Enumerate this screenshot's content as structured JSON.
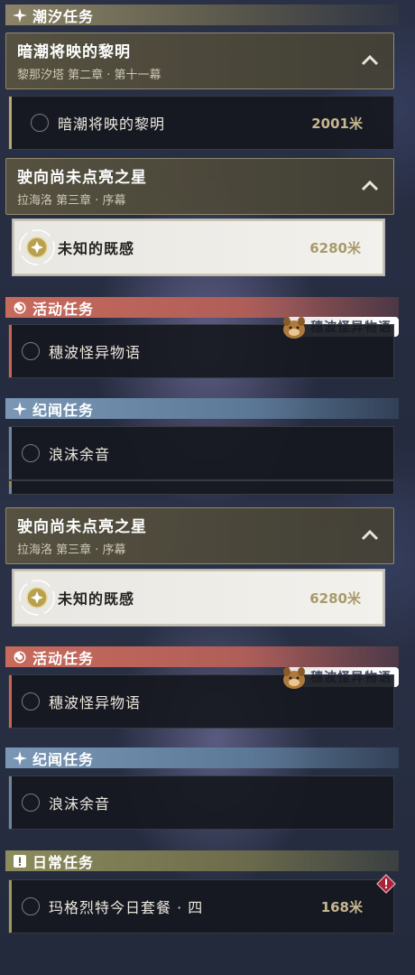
{
  "sections": {
    "tide": "潮汐任务",
    "event": "活动任务",
    "lore": "纪闻任务",
    "daily": "日常任务"
  },
  "chapter1": {
    "title": "暗潮将映的黎明",
    "subtitle": "黎那汐塔 第二章 · 第十一幕"
  },
  "quest1": {
    "name": "暗潮将映的黎明",
    "distance": "2001米"
  },
  "chapter2": {
    "title": "驶向尚未点亮之星",
    "subtitle": "拉海洛 第三章 · 序幕"
  },
  "quest2": {
    "name": "未知的既感",
    "distance": "6280米"
  },
  "event_quest": {
    "name": "穗波怪异物语",
    "badge": "穗波怪异物语"
  },
  "lore_quest": {
    "name": "浪沫余音"
  },
  "daily_quest": {
    "name": "玛格烈特今日套餐 · 四",
    "distance": "168米"
  },
  "colors": {
    "tide_header": "#8c8468",
    "event_header": "#c86a5c",
    "lore_header": "#7a98b6",
    "daily_header": "#8c8c5c",
    "active_row": "#f0eee9",
    "distance_gold": "#c8b890"
  },
  "icons": {
    "tide_header": "sparkle-icon",
    "event_header": "swirl-icon",
    "lore_header": "sparkle-icon",
    "daily_header": "exclamation-box-icon",
    "chapter_toggle": "chevron-up-icon",
    "track": "compass-target-icon",
    "badge": "dog-mascot-icon",
    "warning": "warning-diamond-icon"
  }
}
